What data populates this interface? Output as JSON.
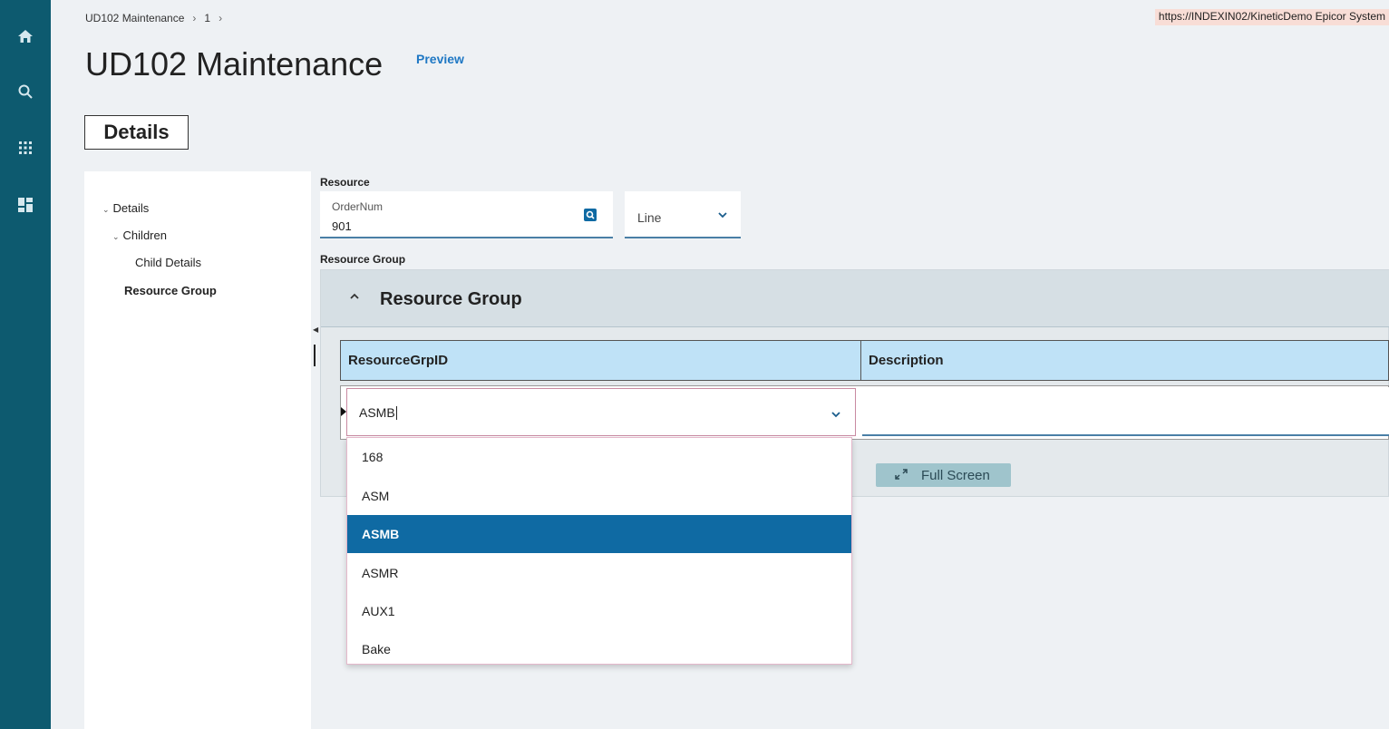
{
  "breadcrumb": {
    "items": [
      "UD102 Maintenance",
      "1"
    ],
    "separator": "›"
  },
  "url_banner": "https://INDEXIN02/KineticDemo  Epicor System",
  "page": {
    "title": "UD102 Maintenance",
    "preview": "Preview"
  },
  "details_button": "Details",
  "tree": {
    "details": "Details",
    "children": "Children",
    "child_details": "Child Details",
    "resource_group": "Resource Group"
  },
  "form": {
    "resource_label": "Resource",
    "ordernum_label": "OrderNum",
    "ordernum_value": "901",
    "line_value": "Line",
    "resource_group_label": "Resource Group"
  },
  "resource_group_panel": {
    "title": "Resource Group",
    "columns": [
      "ResourceGrpID",
      "Description"
    ],
    "row": {
      "resource_grp_id": "ASMB",
      "description": ""
    },
    "full_screen": "Full Screen"
  },
  "dropdown": {
    "options": [
      "168",
      "ASM",
      "ASMB",
      "ASMR",
      "AUX1",
      "Bake"
    ],
    "selected": "ASMB"
  },
  "colors": {
    "rail": "#0d5a6f",
    "accent": "#0f6aa3",
    "grid_header": "#bfe2f7"
  }
}
